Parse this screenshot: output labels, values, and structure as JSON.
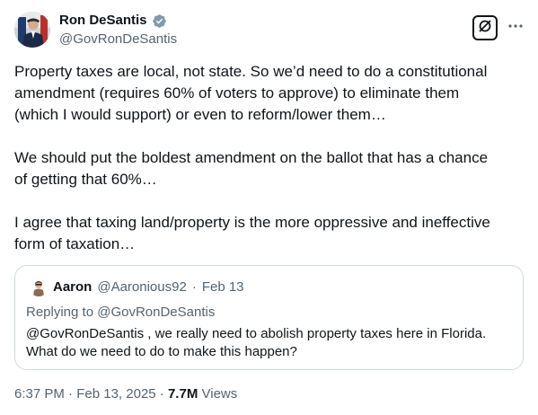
{
  "author": {
    "display_name": "Ron DeSantis",
    "handle": "@GovRonDeSantis",
    "verified": true
  },
  "tweet": {
    "paragraphs": [
      {
        "lines": [
          "Property taxes are local, not state.  So we’d need to do a constitutional",
          "amendment (requires 60% of voters to approve) to eliminate them",
          "(which I would support) or even to reform/lower them…"
        ]
      },
      {
        "lines": [
          "We should put the boldest amendment on the ballot that has a chance",
          "of getting that 60%…"
        ]
      },
      {
        "lines": [
          "I agree that taxing land/property is the more oppressive and ineffective",
          "form of taxation…"
        ]
      }
    ]
  },
  "quoted": {
    "display_name": "Aaron",
    "handle": "@Aaronious92",
    "separator": "·",
    "date": "Feb 13",
    "replying_prefix": "Replying to",
    "replying_to": "@GovRonDeSantis",
    "lines": [
      "@GovRonDeSantis , we really need to abolish property taxes here in Florida.",
      "What do we need to do to make this happen?"
    ]
  },
  "footer": {
    "time": "6:37 PM",
    "sep1": "·",
    "date": "Feb 13, 2025",
    "sep2": "·",
    "views_count": "7.7M",
    "views_label": "Views"
  },
  "icons": {
    "verified": "verified-badge-icon",
    "grok": "grok-icon",
    "more": "more-options-icon"
  },
  "colors": {
    "text": "#0f1419",
    "secondary": "#536471",
    "verified": "#829aab",
    "border": "#cfd9de"
  }
}
